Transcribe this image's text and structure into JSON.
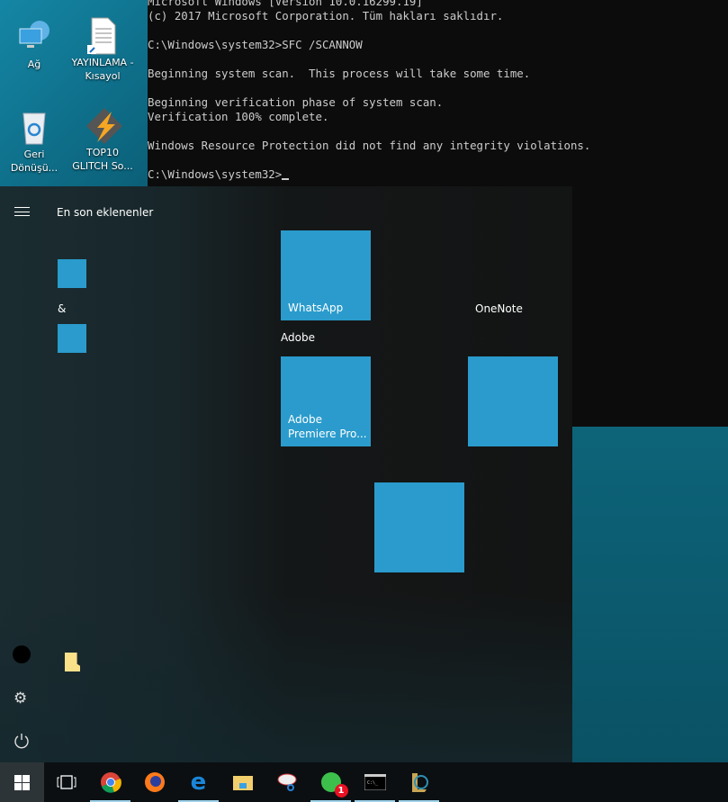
{
  "desktop": {
    "icons": [
      {
        "label": "Ağ",
        "icon": "network-icon"
      },
      {
        "label": "YAYINLAMA - Kısayol",
        "icon": "document-shortcut-icon"
      },
      {
        "label": "Geri Dönüşü...",
        "icon": "recycle-bin-icon"
      },
      {
        "label": "TOP10 GLITCH So...",
        "icon": "winamp-icon"
      }
    ]
  },
  "cmd": {
    "lines": [
      "Microsoft Windows [Version 10.0.16299.19]",
      "(c) 2017 Microsoft Corporation. Tüm hakları saklıdır.",
      "",
      "C:\\Windows\\system32>SFC /SCANNOW",
      "",
      "Beginning system scan.  This process will take some time.",
      "",
      "Beginning verification phase of system scan.",
      "Verification 100% complete.",
      "",
      "Windows Resource Protection did not find any integrity violations.",
      "",
      "C:\\Windows\\system32>"
    ]
  },
  "start": {
    "section_title": "En son eklenenler",
    "list_header": "&",
    "tiles": {
      "whatsapp": "WhatsApp",
      "onenote": "OneNote",
      "group_adobe": "Adobe",
      "premiere_1": "Adobe",
      "premiere_2": "Premiere Pro..."
    }
  },
  "colors": {
    "tile": "#2a9bcc",
    "start_bg": "#141718",
    "taskbar": "#0b0f12"
  },
  "taskbar": {
    "items": [
      "start-button",
      "task-view",
      "chrome",
      "firefox",
      "edge",
      "file-explorer",
      "snipping-tool",
      "whatsapp",
      "command-prompt",
      "league-of-legends"
    ],
    "whatsapp_badge": "1"
  }
}
